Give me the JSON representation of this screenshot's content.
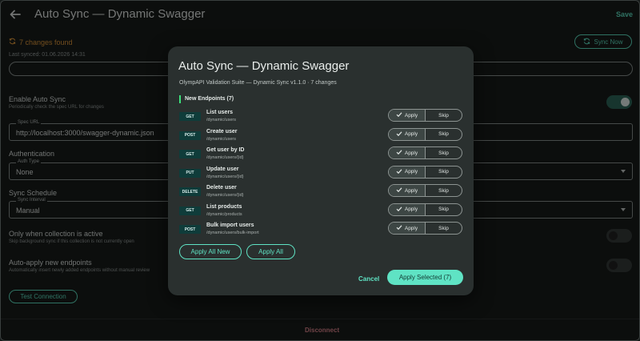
{
  "header": {
    "title": "Auto Sync — Dynamic Swagger",
    "save_label": "Save"
  },
  "status": {
    "changes_found": "7 changes found",
    "last_synced": "Last synced: 01.06.2026 14:31",
    "sync_now_label": "Sync Now"
  },
  "auto_sync": {
    "title": "Enable Auto Sync",
    "description": "Periodically check the spec URL for changes",
    "enabled": true
  },
  "spec_url": {
    "label": "Spec URL",
    "value": "http://localhost:3000/swagger-dynamic.json"
  },
  "authentication": {
    "title": "Authentication",
    "auth_type_label": "Auth Type",
    "auth_type_value": "None"
  },
  "sync_schedule": {
    "title": "Sync Schedule",
    "interval_label": "Sync Interval",
    "interval_value": "Manual"
  },
  "only_active": {
    "title": "Only when collection is active",
    "description": "Skip background sync if this collection is not currently open",
    "enabled": false
  },
  "auto_apply": {
    "title": "Auto-apply new endpoints",
    "description": "Automatically insert newly added endpoints without manual review",
    "enabled": false
  },
  "test_connection_label": "Test Connection",
  "disconnect_label": "Disconnect",
  "modal": {
    "title": "Auto Sync — Dynamic Swagger",
    "subtitle": "OlympAPI Validation Suite — Dynamic Sync v1.1.0 · 7 changes",
    "section_title": "New Endpoints (7)",
    "apply_label": "Apply",
    "skip_label": "Skip",
    "endpoints": [
      {
        "method": "GET",
        "name": "List users",
        "path": "/dynamic/users"
      },
      {
        "method": "POST",
        "name": "Create user",
        "path": "/dynamic/users"
      },
      {
        "method": "GET",
        "name": "Get user by ID",
        "path": "/dynamic/users/{id}"
      },
      {
        "method": "PUT",
        "name": "Update user",
        "path": "/dynamic/users/{id}"
      },
      {
        "method": "DELETE",
        "name": "Delete user",
        "path": "/dynamic/users/{id}"
      },
      {
        "method": "GET",
        "name": "List products",
        "path": "/dynamic/products"
      },
      {
        "method": "POST",
        "name": "Bulk import users",
        "path": "/dynamic/users/bulk-import"
      }
    ],
    "apply_all_new_label": "Apply All New",
    "apply_all_label": "Apply All",
    "cancel_label": "Cancel",
    "apply_selected_label": "Apply Selected (7)"
  },
  "colors": {
    "accent": "#5fe3c4",
    "warning": "#e39a3b",
    "danger": "#e0868f",
    "method_badge": "#0f3c3a"
  }
}
